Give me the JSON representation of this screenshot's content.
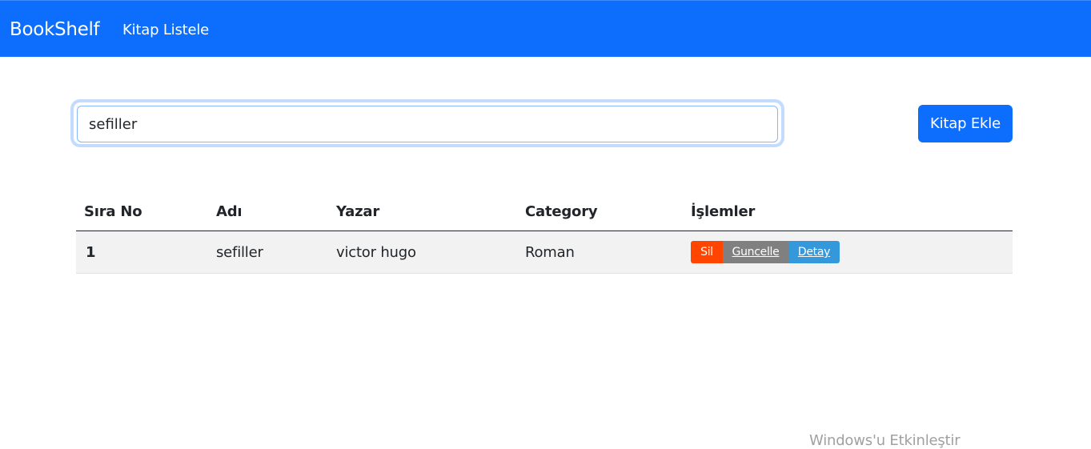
{
  "navbar": {
    "brand": "BookShelf",
    "link_list": "Kitap Listele",
    "color": "#0d6efd"
  },
  "search": {
    "value": "sefiller"
  },
  "add_button": {
    "label": "Kitap Ekle"
  },
  "table": {
    "headers": {
      "index": "Sıra No",
      "name": "Adı",
      "author": "Yazar",
      "category": "Category",
      "actions": "İşlemler"
    },
    "rows": [
      {
        "index": "1",
        "name": "sefiller",
        "author": "victor hugo",
        "category": "Roman",
        "actions": {
          "delete": "Sil",
          "update": "Guncelle",
          "detail": "Detay"
        }
      }
    ]
  },
  "action_colors": {
    "delete": "#ff4500",
    "update": "#808080",
    "detail": "#3498db"
  },
  "watermark": "Windows'u Etkinleştir"
}
